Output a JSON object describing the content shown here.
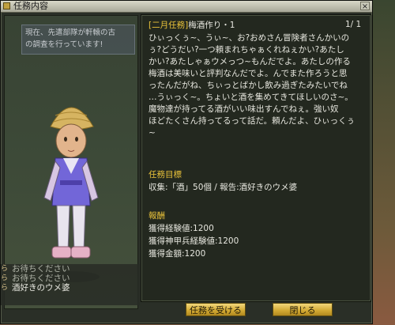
{
  "window": {
    "title": "任務内容",
    "close_glyph": "×"
  },
  "npc": {
    "speech": "現在、先遣部隊が軒轅の古\nの調査を行っています!",
    "chat_log": [
      "お待ちください",
      "お待ちください",
      "酒好きのウメ婆"
    ],
    "chat_markers": [
      "ら",
      "ら",
      "ら"
    ]
  },
  "quest": {
    "title_bracket": "[二月任務]",
    "title_name": "梅酒作り・1",
    "page": "1/ 1",
    "body_lines": [
      "ひぃっくぅ~、うぃ~、お?おめさん冒険者さんかいの",
      "ぅ?どうだい?一つ頼まれちゃぁくれねぇかい?あたし",
      "かい?あたしゃぁウメっつ~もんだでよ。あたしの作る",
      "梅酒は美味いと評判なんだでよ。んでまた作ろうと思",
      "ったんだがね、ちぃっとばかし飲み過ぎたみたいでね",
      "…うぃっく~。ちょいと酒を集めてきてほしいのさ~。",
      "魔物達が持ってる酒がいい味出すんでねぇ。強い奴",
      "ほどたくさん持ってるって話だ。頼んだよ、ひぃっくぅ",
      "~"
    ],
    "objective_heading": "任務目標",
    "objective_text": "収集:「酒」50個 / 報告:酒好きのウメ婆",
    "reward_heading": "報酬",
    "rewards": [
      "獲得経験値:1200",
      "獲得神甲兵経験値:1200",
      "獲得金額:1200"
    ]
  },
  "buttons": {
    "accept": "任務を受ける",
    "close": "閉じる"
  },
  "colors": {
    "accent": "#e9c23a",
    "panel_bg": "#23281f",
    "button_gold": "#d1a831"
  }
}
